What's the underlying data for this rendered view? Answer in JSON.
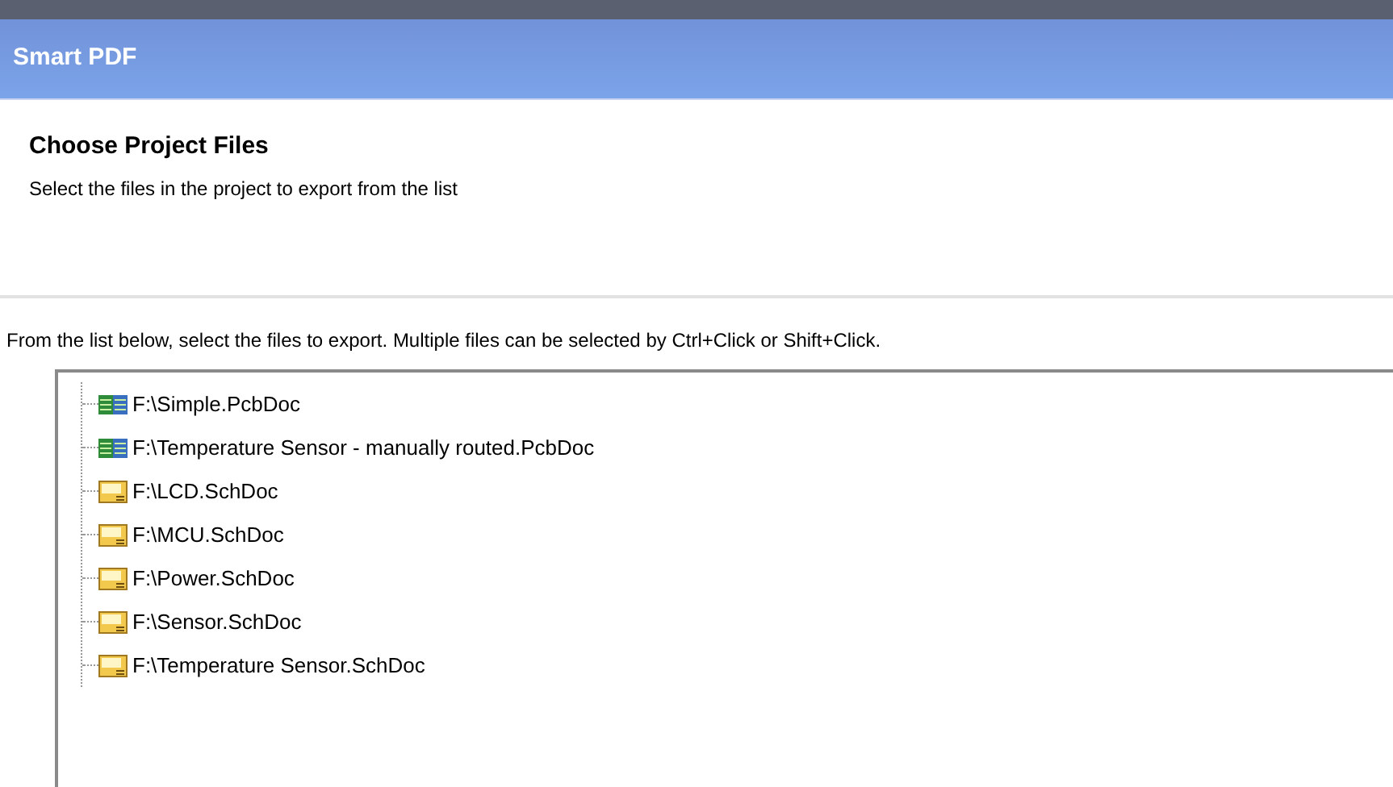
{
  "window": {
    "title": "Smart PDF"
  },
  "header": {
    "title": "Choose Project Files",
    "subtitle": "Select the files in the project to export from the list"
  },
  "instruction": "From the list below, select the files to export. Multiple files can be selected by Ctrl+Click or Shift+Click.",
  "files": [
    {
      "kind": "pcb",
      "name": "F:\\Simple.PcbDoc"
    },
    {
      "kind": "pcb",
      "name": "F:\\Temperature Sensor - manually routed.PcbDoc"
    },
    {
      "kind": "sch",
      "name": "F:\\LCD.SchDoc"
    },
    {
      "kind": "sch",
      "name": "F:\\MCU.SchDoc"
    },
    {
      "kind": "sch",
      "name": "F:\\Power.SchDoc"
    },
    {
      "kind": "sch",
      "name": "F:\\Sensor.SchDoc"
    },
    {
      "kind": "sch",
      "name": "F:\\Temperature Sensor.SchDoc"
    }
  ]
}
